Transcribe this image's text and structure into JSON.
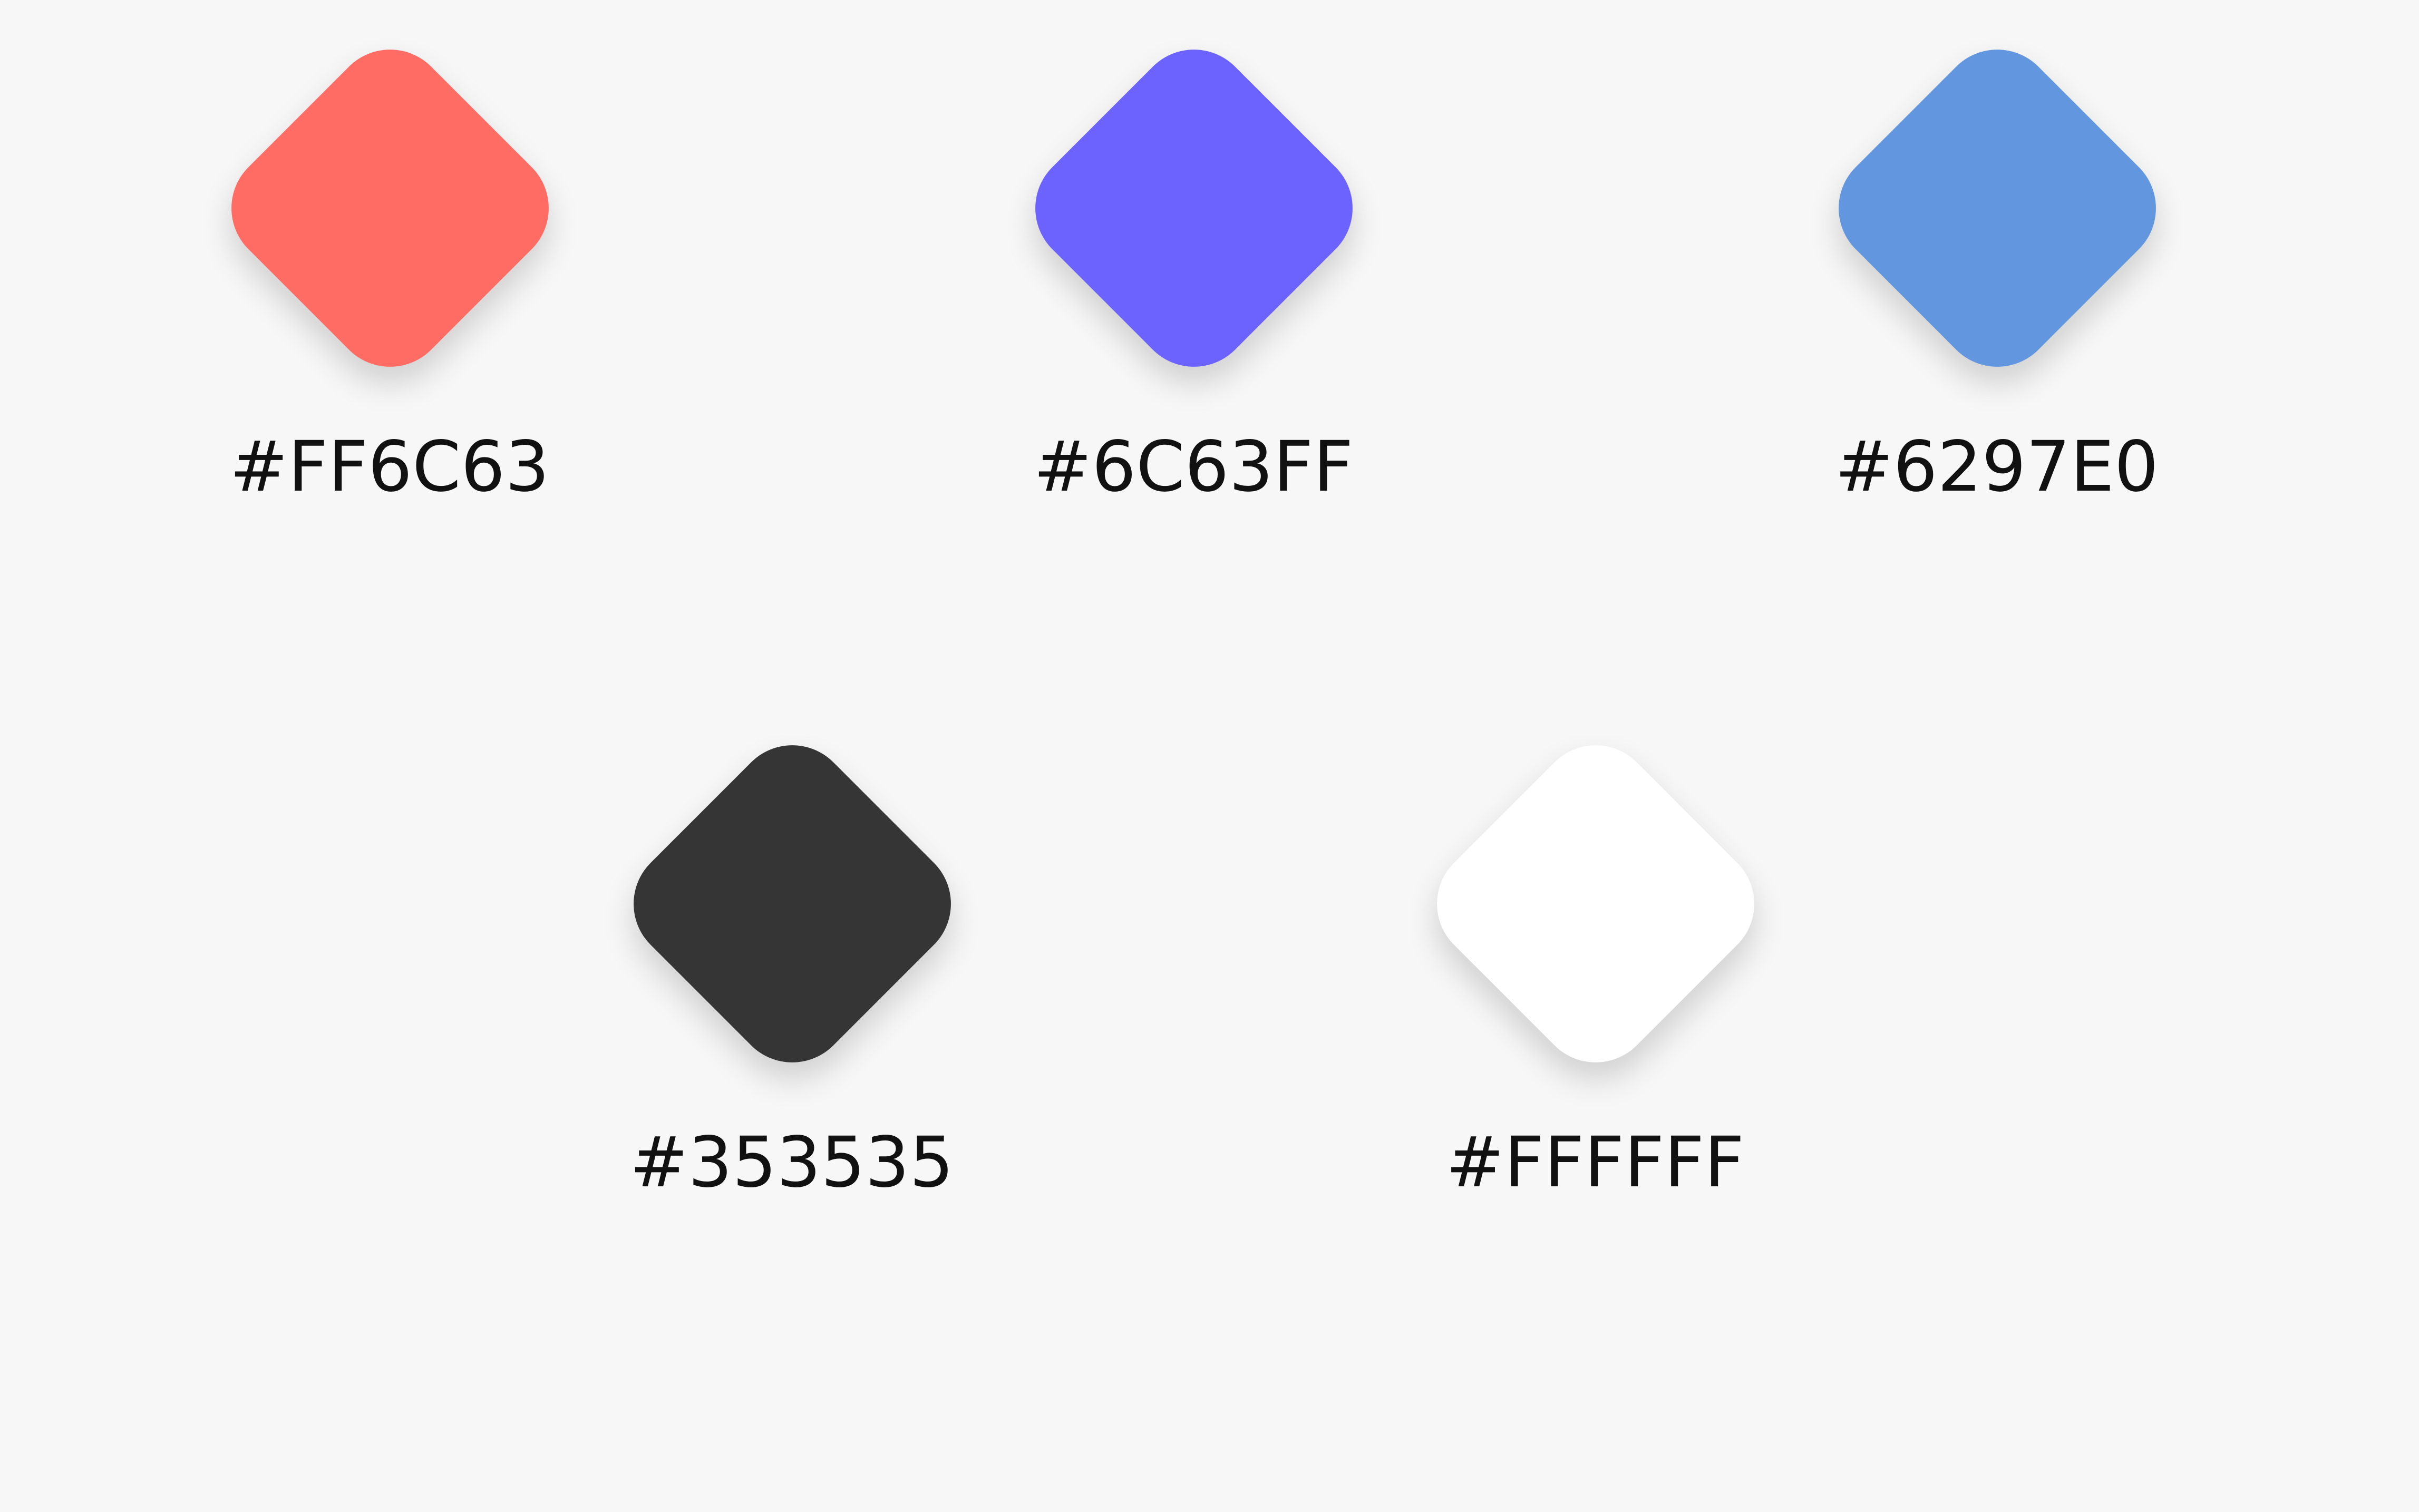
{
  "palette": {
    "swatches": [
      {
        "color": "#FF6C63",
        "label": "#FF6C63"
      },
      {
        "color": "#6C63FF",
        "label": "#6C63FF"
      },
      {
        "color": "#6297E0",
        "label": "#6297E0"
      },
      {
        "color": "#353535",
        "label": "#353535"
      },
      {
        "color": "#FFFFFF",
        "label": "#FFFFFF"
      }
    ]
  }
}
